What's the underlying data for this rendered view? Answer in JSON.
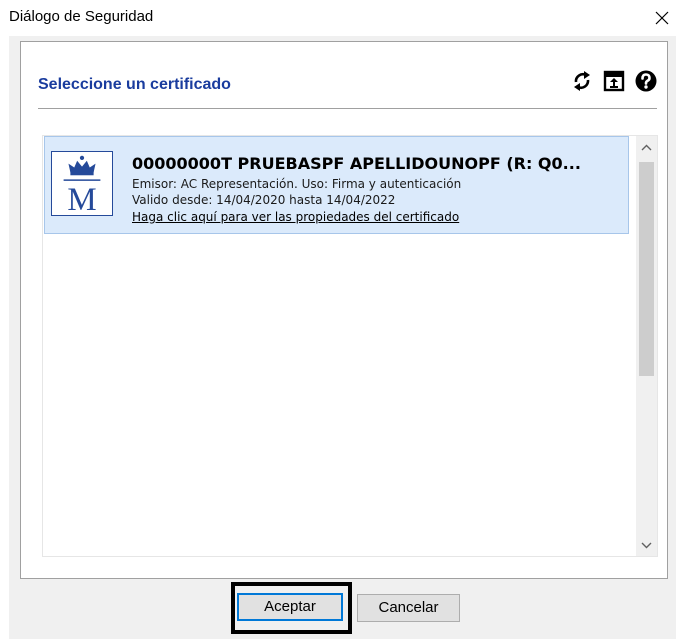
{
  "window": {
    "title": "Diálogo de Seguridad"
  },
  "header": {
    "title": "Seleccione un certificado"
  },
  "certificate": {
    "name": "00000000T PRUEBASPF APELLIDOUNOPF (R: Q0...",
    "issuer": "Emisor: AC Representación. Uso: Firma y autenticación",
    "validity": "Valido desde: 14/04/2020 hasta 14/04/2022",
    "details_link": "Haga clic aquí para ver las propiedades del certificado"
  },
  "buttons": {
    "accept": "Aceptar",
    "cancel": "Cancelar"
  },
  "icons": {
    "close": "close-icon",
    "refresh": "refresh-icon",
    "open_file": "open-certificate-icon",
    "help": "help-icon",
    "cert_logo": "royal-crown-m-logo",
    "scroll_up": "chevron-up-icon",
    "scroll_down": "chevron-down-icon"
  },
  "colors": {
    "title_blue": "#1a3c9e",
    "selection_bg": "#dbeafb",
    "selection_border": "#a7c6ea",
    "default_button_border": "#0078d7"
  }
}
